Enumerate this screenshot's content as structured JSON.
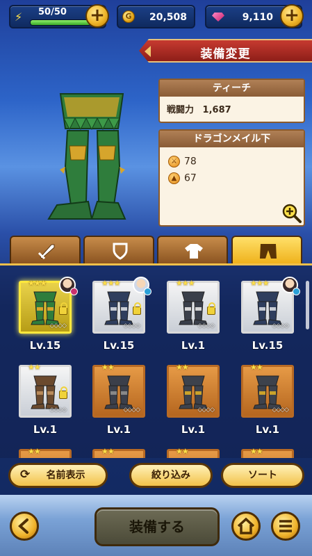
{
  "status": {
    "stamina_text": "50/50",
    "stamina_fraction": 1.0,
    "gold": "20,508",
    "gems": "9,110",
    "colors": {
      "stamina_fill": "#5ccf3d",
      "plus_button": "#f0b62b"
    }
  },
  "header": {
    "title": "装備変更"
  },
  "character": {
    "name": "ティーチ",
    "power_label": "戦闘力",
    "power_value": "1,687"
  },
  "item": {
    "name": "ドラゴンメイル下",
    "stats": [
      {
        "icon": "attack-icon",
        "value": "78"
      },
      {
        "icon": "defense-icon",
        "value": "67"
      }
    ]
  },
  "tabs": [
    {
      "icon": "sword-icon",
      "active": false
    },
    {
      "icon": "shield-icon",
      "active": false
    },
    {
      "icon": "armor-top-icon",
      "active": false
    },
    {
      "icon": "armor-bottom-icon",
      "active": true
    }
  ],
  "items": [
    {
      "level": "Lv.15",
      "stars": 3,
      "frame": "gold",
      "locked": true,
      "equipped_by": true,
      "selected": true
    },
    {
      "level": "Lv.15",
      "stars": 3,
      "frame": "silver",
      "locked": true,
      "equipped_by": true,
      "selected": false
    },
    {
      "level": "Lv.1",
      "stars": 3,
      "frame": "silver",
      "locked": true,
      "equipped_by": false,
      "selected": false
    },
    {
      "level": "Lv.15",
      "stars": 3,
      "frame": "silver",
      "locked": false,
      "equipped_by": true,
      "selected": false
    },
    {
      "level": "Lv.1",
      "stars": 2,
      "frame": "silver",
      "locked": true,
      "equipped_by": false,
      "selected": false
    },
    {
      "level": "Lv.1",
      "stars": 2,
      "frame": "bronze",
      "locked": false,
      "equipped_by": false,
      "selected": false
    },
    {
      "level": "Lv.1",
      "stars": 2,
      "frame": "bronze",
      "locked": false,
      "equipped_by": false,
      "selected": false
    },
    {
      "level": "Lv.1",
      "stars": 2,
      "frame": "bronze",
      "locked": false,
      "equipped_by": false,
      "selected": false
    }
  ],
  "actions": {
    "name_display": "名前表示",
    "filter": "絞り込み",
    "sort": "ソート",
    "equip": "装備する"
  }
}
